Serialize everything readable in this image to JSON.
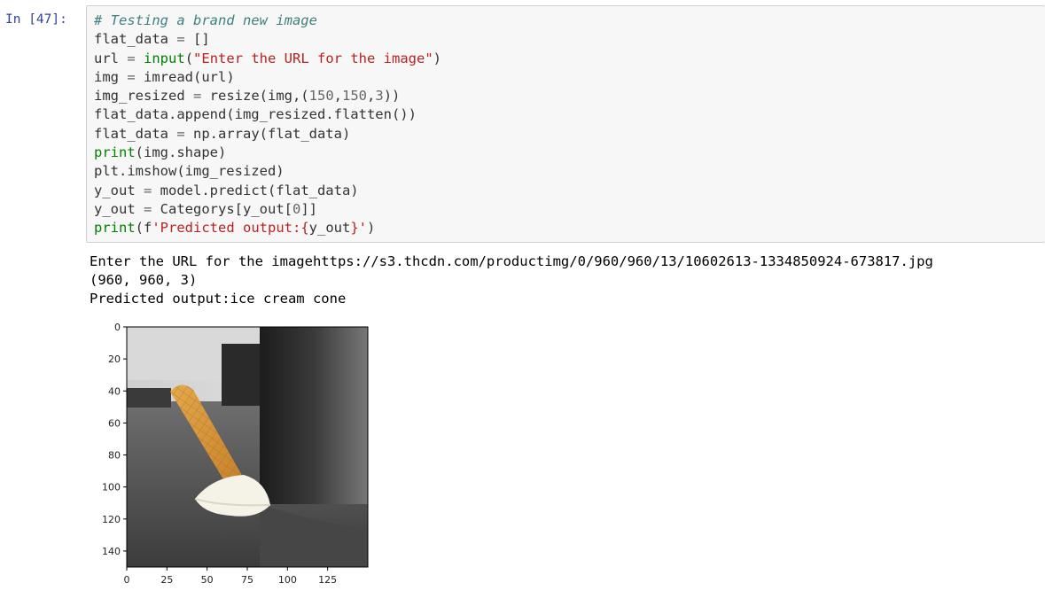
{
  "cell": {
    "prompt": "In [47]:",
    "code_lines": [
      [
        {
          "t": "cm",
          "v": "# Testing a brand new image"
        }
      ],
      [
        {
          "t": "",
          "v": "flat_data "
        },
        {
          "t": "op",
          "v": "="
        },
        {
          "t": "",
          "v": " []"
        }
      ],
      [
        {
          "t": "",
          "v": "url "
        },
        {
          "t": "op",
          "v": "="
        },
        {
          "t": "",
          "v": " "
        },
        {
          "t": "bi",
          "v": "input"
        },
        {
          "t": "",
          "v": "("
        },
        {
          "t": "st",
          "v": "\"Enter the URL for the image\""
        },
        {
          "t": "",
          "v": ")"
        }
      ],
      [
        {
          "t": "",
          "v": "img "
        },
        {
          "t": "op",
          "v": "="
        },
        {
          "t": "",
          "v": " imread(url)"
        }
      ],
      [
        {
          "t": "",
          "v": "img_resized "
        },
        {
          "t": "op",
          "v": "="
        },
        {
          "t": "",
          "v": " resize(img,("
        },
        {
          "t": "nm",
          "v": "150"
        },
        {
          "t": "",
          "v": ","
        },
        {
          "t": "nm",
          "v": "150"
        },
        {
          "t": "",
          "v": ","
        },
        {
          "t": "nm",
          "v": "3"
        },
        {
          "t": "",
          "v": "))"
        }
      ],
      [
        {
          "t": "",
          "v": "flat_data.append(img_resized.flatten())"
        }
      ],
      [
        {
          "t": "",
          "v": "flat_data "
        },
        {
          "t": "op",
          "v": "="
        },
        {
          "t": "",
          "v": " np.array(flat_data)"
        }
      ],
      [
        {
          "t": "bi",
          "v": "print"
        },
        {
          "t": "",
          "v": "(img.shape)"
        }
      ],
      [
        {
          "t": "",
          "v": "plt.imshow(img_resized)"
        }
      ],
      [
        {
          "t": "",
          "v": "y_out "
        },
        {
          "t": "op",
          "v": "="
        },
        {
          "t": "",
          "v": " model.predict(flat_data)"
        }
      ],
      [
        {
          "t": "",
          "v": "y_out "
        },
        {
          "t": "op",
          "v": "="
        },
        {
          "t": "",
          "v": " Categorys[y_out["
        },
        {
          "t": "nm",
          "v": "0"
        },
        {
          "t": "",
          "v": "]]"
        }
      ],
      [
        {
          "t": "bi",
          "v": "print"
        },
        {
          "t": "",
          "v": "(f"
        },
        {
          "t": "st",
          "v": "'Predicted output:{"
        },
        {
          "t": "",
          "v": "y_out"
        },
        {
          "t": "st",
          "v": "}'"
        },
        {
          "t": "",
          "v": ")"
        }
      ]
    ]
  },
  "output": {
    "lines": [
      "Enter the URL for the imagehttps://s3.thcdn.com/productimg/0/960/960/13/10602613-1334850924-673817.jpg",
      "(960, 960, 3)",
      "Predicted output:ice cream cone"
    ]
  },
  "plot": {
    "x_ticks": [
      0,
      25,
      50,
      75,
      100,
      125
    ],
    "y_ticks": [
      0,
      20,
      40,
      60,
      80,
      100,
      120,
      140
    ],
    "xlim": [
      0,
      150
    ],
    "ylim": [
      150,
      0
    ]
  },
  "colors": {
    "prompt": "#303f9f",
    "comment": "#408080",
    "builtin": "#008000",
    "string": "#ba2121",
    "number": "#666666",
    "input_bg": "#f7f7f7",
    "input_border": "#cfcfcf"
  }
}
